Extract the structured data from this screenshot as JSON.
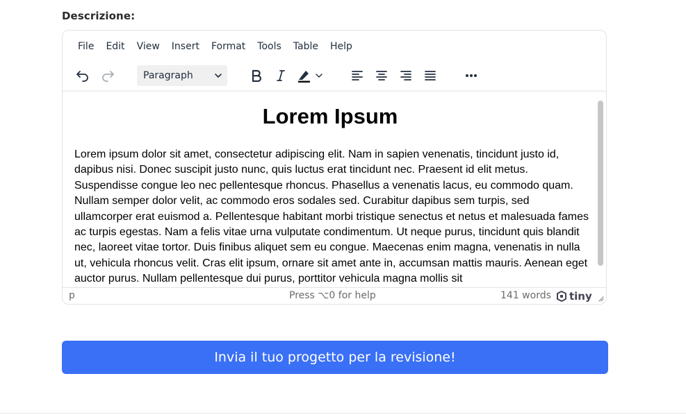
{
  "form": {
    "description_label": "Descrizione:",
    "submit_label": "Invia il tuo progetto per la revisione!"
  },
  "editor": {
    "menu": [
      "File",
      "Edit",
      "View",
      "Insert",
      "Format",
      "Tools",
      "Table",
      "Help"
    ],
    "toolbar": {
      "block_format": "Paragraph",
      "buttons": [
        "undo",
        "redo",
        "bold",
        "italic",
        "highlight-color",
        "align-left",
        "align-center",
        "align-right",
        "justify",
        "more"
      ]
    },
    "content": {
      "heading": "Lorem Ipsum",
      "paragraph": "Lorem ipsum dolor sit amet, consectetur adipiscing elit. Nam in sapien venenatis, tincidunt justo id, dapibus nisi. Donec suscipit justo nunc, quis luctus erat tincidunt nec. Praesent id elit metus. Suspendisse congue leo nec pellentesque rhoncus. Phasellus a venenatis lacus, eu commodo quam. Nullam semper dolor velit, ac commodo eros sodales sed. Curabitur dapibus sem turpis, sed ullamcorper erat euismod a. Pellentesque habitant morbi tristique senectus et netus et malesuada fames ac turpis egestas. Nam a felis vitae urna vulputate condimentum. Ut neque purus, tincidunt quis blandit nec, laoreet vitae tortor. Duis finibus aliquet sem eu congue. Maecenas enim magna, venenatis in nulla ut, vehicula rhoncus velit. Cras elit ipsum, ornare sit amet ante in, accumsan mattis mauris. Aenean eget auctor purus. Nullam pellentesque dui purus, porttitor vehicula magna mollis sit"
    },
    "status": {
      "path": "p",
      "help": "Press ⌥0 for help",
      "word_count": "141 words",
      "brand": "tiny"
    }
  },
  "colors": {
    "accent": "#3a70f5",
    "text": "#222f3e"
  }
}
